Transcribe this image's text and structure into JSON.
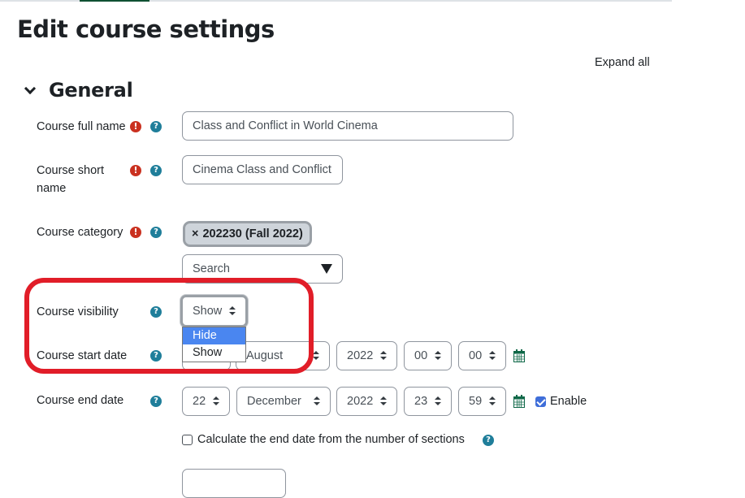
{
  "page": {
    "title": "Edit course settings",
    "expand_all": "Expand all"
  },
  "section": {
    "title": "General"
  },
  "fields": {
    "full_name": {
      "label": "Course full name",
      "value": "Class and Conflict in World Cinema",
      "required_icon": "!",
      "help_icon": "?"
    },
    "short_name": {
      "label_line1": "Course short",
      "label_line2": "name",
      "value": "Cinema Class and Conflict",
      "required_icon": "!",
      "help_icon": "?"
    },
    "category": {
      "label": "Course category",
      "selected_chip_x": "×",
      "selected_chip": "202230 (Fall 2022)",
      "search_placeholder": "Search",
      "required_icon": "!",
      "help_icon": "?"
    },
    "visibility": {
      "label": "Course visibility",
      "value": "Show",
      "help_icon": "?",
      "options": [
        "Hide",
        "Show"
      ],
      "highlighted_option": "Hide"
    },
    "start_date": {
      "label": "Course start date",
      "help_icon": "?",
      "month": "August",
      "year": "2022",
      "hour": "00",
      "minute": "00"
    },
    "end_date": {
      "label": "Course end date",
      "help_icon": "?",
      "day": "22",
      "month": "December",
      "year": "2022",
      "hour": "23",
      "minute": "59",
      "enable_label": "Enable",
      "enabled": true
    },
    "calculate_end": {
      "label": "Calculate the end date from the number of sections",
      "checked": false,
      "help_icon": "?"
    }
  },
  "colors": {
    "required": "#ca3120",
    "help": "#1f7e9a",
    "highlight_ring": "#e11d28",
    "dropdown_selected": "#4a86f0",
    "calendar": "#0f6848",
    "checkbox": "#3f6ed9"
  }
}
